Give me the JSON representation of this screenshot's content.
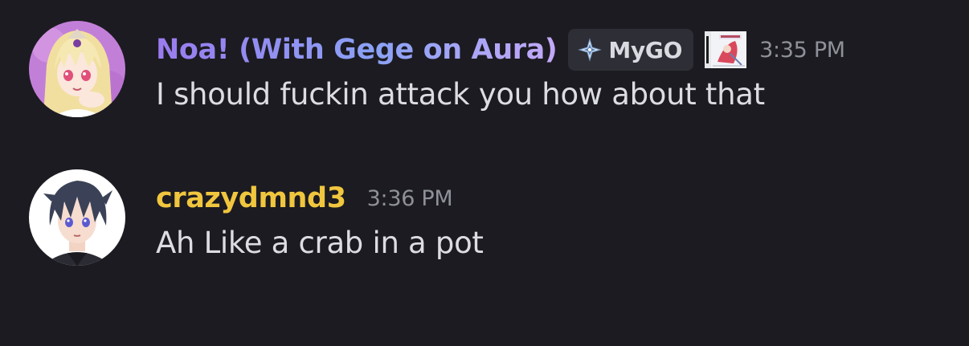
{
  "messages": [
    {
      "username": "Noa! (With Gege on Aura)",
      "tag_icon": "diamond-cross-icon",
      "tag_label": "MyGO",
      "game_icon": "game-cover-icon",
      "timestamp": "3:35 PM",
      "text": "I should fuckin attack you how about that",
      "avatar": "anime-girl-avatar"
    },
    {
      "username": "crazydmnd3",
      "timestamp": "3:36 PM",
      "text": "Ah Like a crab in a pot",
      "avatar": "anime-boy-avatar"
    }
  ],
  "colors": {
    "background": "#1c1b21",
    "username_1_gradient": [
      "#9a7bef",
      "#8aa2f5",
      "#c4a8f8"
    ],
    "username_2": "#f0c63e",
    "timestamp": "#8e9199",
    "message_text": "#dcdde2",
    "tag_background": "#2e2e36"
  }
}
